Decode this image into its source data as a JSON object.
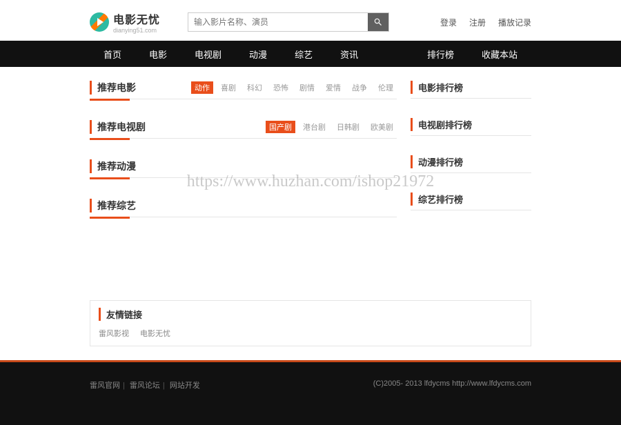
{
  "logo": {
    "title": "电影无忧",
    "sub": "dianying51.com"
  },
  "search": {
    "placeholder": "输入影片名称、演员"
  },
  "user_links": {
    "login": "登录",
    "register": "注册",
    "history": "播放记录"
  },
  "nav": {
    "items": [
      "首页",
      "电影",
      "电视剧",
      "动漫",
      "综艺",
      "资讯"
    ],
    "right": [
      "排行榜",
      "收藏本站"
    ]
  },
  "sections": {
    "movie": {
      "title": "推荐电影",
      "tags": [
        "动作",
        "喜剧",
        "科幻",
        "恐怖",
        "剧情",
        "爱情",
        "战争",
        "伦理"
      ]
    },
    "tv": {
      "title": "推荐电视剧",
      "tags": [
        "国产剧",
        "港台剧",
        "日韩剧",
        "欧美剧"
      ]
    },
    "anime": {
      "title": "推荐动漫"
    },
    "variety": {
      "title": "推荐综艺"
    }
  },
  "ranks": {
    "movie": "电影排行榜",
    "tv": "电视剧排行榜",
    "anime": "动漫排行榜",
    "variety": "综艺排行榜"
  },
  "friendlinks": {
    "title": "友情链接",
    "items": [
      "雷风影视",
      "电影无忧"
    ]
  },
  "footer": {
    "left": [
      "雷风官网",
      "雷风论坛",
      "网站开发"
    ],
    "right": "(C)2005- 2013 lfdycms http://www.lfdycms.com"
  },
  "watermark": "https://www.huzhan.com/ishop21972"
}
